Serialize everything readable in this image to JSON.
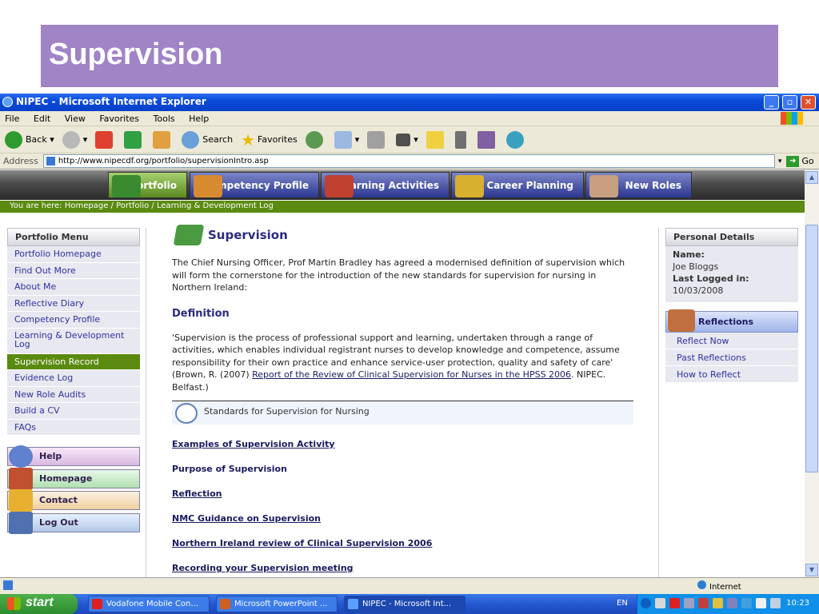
{
  "slide": {
    "title": "Supervision"
  },
  "window": {
    "title": "NIPEC - Microsoft Internet Explorer"
  },
  "menubar": [
    "File",
    "Edit",
    "View",
    "Favorites",
    "Tools",
    "Help"
  ],
  "toolbar": {
    "back": "Back",
    "search": "Search",
    "favorites": "Favorites"
  },
  "address": {
    "label": "Address",
    "url": "http://www.nipecdf.org/portfolio/supervisionIntro.asp",
    "go": "Go"
  },
  "nav": {
    "tabs": [
      "Portfolio",
      "Competency Profile",
      "Learning Activities",
      "Career Planning",
      "New Roles"
    ]
  },
  "breadcrumb": "You are here: Homepage / Portfolio / Learning & Development Log",
  "portfolio_menu": {
    "heading": "Portfolio Menu",
    "items": [
      "Portfolio Homepage",
      "Find Out More",
      "About Me",
      "Reflective Diary",
      "Competency Profile",
      "Learning & Development Log",
      "Supervision Record",
      "Evidence Log",
      "New Role Audits",
      "Build a CV",
      "FAQs"
    ]
  },
  "side_buttons": {
    "help": "Help",
    "homepage": "Homepage",
    "contact": "Contact",
    "logout": "Log Out"
  },
  "content": {
    "title": "Supervision",
    "intro": "The Chief Nursing Officer, Prof Martin Bradley has agreed a modernised definition of supervision which will form the cornerstone for the introduction of the new standards for supervision for nursing in Northern Ireland:",
    "definition_heading": "Definition",
    "definition_text": "'Supervision is the process of professional support and learning, undertaken through a range of activities, which enables individual registrant nurses to develop knowledge and competence, assume responsibility for their own practice and enhance service-user protection, quality and safety of care' (Brown, R. (2007) ",
    "definition_link": "Report of the Review of Clinical Supervision for Nurses in the HPSS 2006",
    "definition_tail": ". NIPEC. Belfast.)",
    "standards_label": "Standards for Supervision for Nursing",
    "links": [
      "Examples of Supervision Activity",
      "Purpose of Supervision",
      "Reflection",
      "NMC Guidance on Supervision",
      "Northern Ireland review of Clinical Supervision 2006",
      "Recording your Supervision meeting"
    ]
  },
  "personal_details": {
    "heading": "Personal Details",
    "name_label": "Name:",
    "name_value": "Joe Bloggs",
    "last_login_label": "Last Logged in:",
    "last_login_value": "10/03/2008"
  },
  "reflections": {
    "heading": "Reflections",
    "items": [
      "Reflect Now",
      "Past Reflections",
      "How to Reflect"
    ]
  },
  "statusbar": {
    "zone": "Internet"
  },
  "taskbar": {
    "start": "start",
    "tasks": [
      "Vodafone Mobile Con...",
      "Microsoft PowerPoint ...",
      "NIPEC - Microsoft Int..."
    ],
    "lang": "EN",
    "clock": "10:23"
  },
  "colors": {
    "slide_title_bg": "#a084c6",
    "nav_green": "#5a8a10",
    "xp_blue": "#2458d0"
  }
}
